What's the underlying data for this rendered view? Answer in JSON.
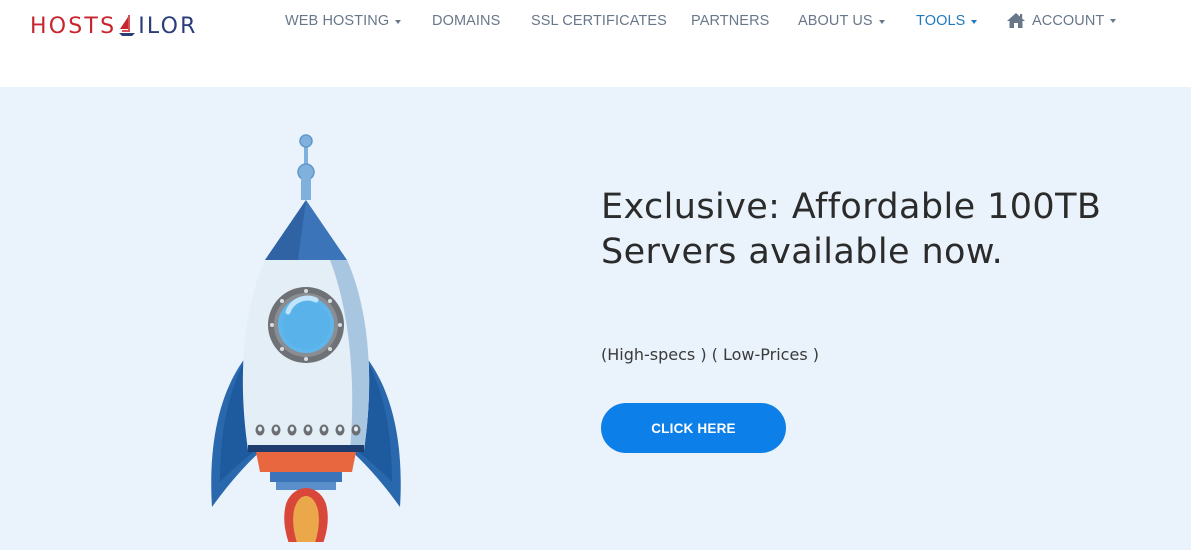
{
  "brand": {
    "logo_part1": "HOSTS",
    "logo_part2": "ILOR",
    "logo_icon": "sailboat-icon"
  },
  "nav": {
    "items": [
      {
        "label": "WEB HOSTING",
        "dropdown": true
      },
      {
        "label": "DOMAINS",
        "dropdown": false
      },
      {
        "label": "SSL CERTIFICATES",
        "dropdown": false
      },
      {
        "label": "PARTNERS",
        "dropdown": false
      },
      {
        "label": "ABOUT US",
        "dropdown": true
      },
      {
        "label": "TOOLS",
        "dropdown": true,
        "active": true
      },
      {
        "label": "ACCOUNT",
        "dropdown": true,
        "icon": "home-icon"
      }
    ]
  },
  "hero": {
    "headline": "Exclusive: Affordable 100TB Servers available now.",
    "subline": "(High-specs ) ( Low-Prices )",
    "cta_label": "CLICK HERE",
    "illustration": "rocket-icon"
  },
  "colors": {
    "brand_red": "#c8262e",
    "brand_blue": "#2a3d7a",
    "nav_text": "#68778a",
    "nav_active": "#1f7bbf",
    "hero_bg": "#eaf3fb",
    "cta_bg": "#0d7fe8"
  }
}
